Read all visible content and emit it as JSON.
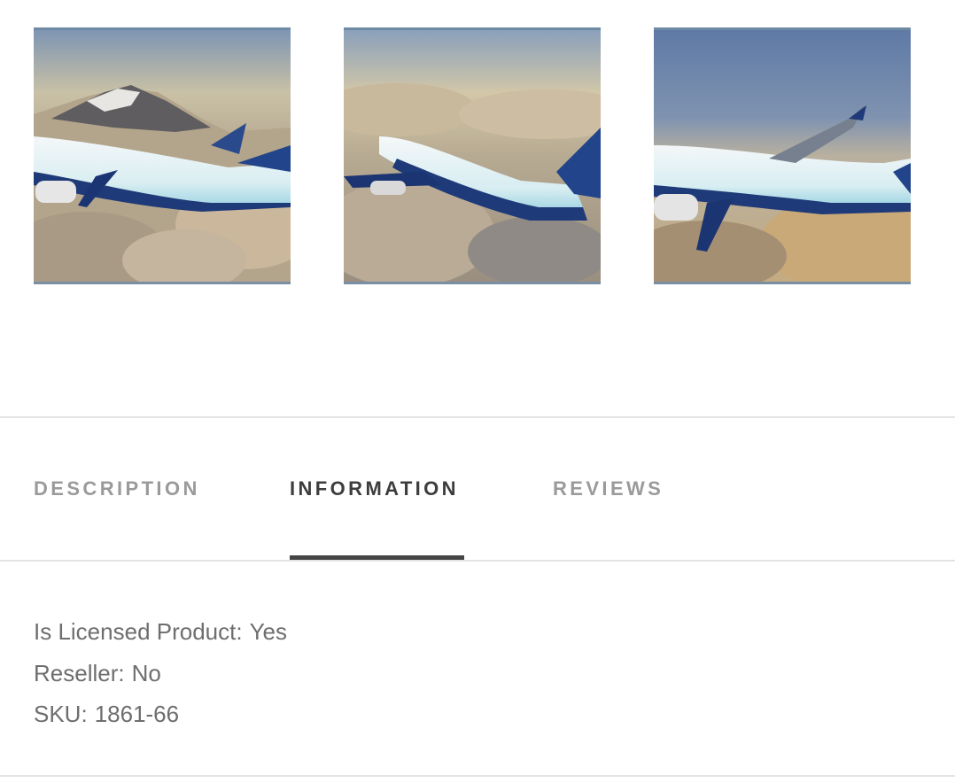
{
  "gallery": {
    "images": [
      {
        "alt": "Boeing 737 over mountain and clouds"
      },
      {
        "alt": "Boeing 737 banking above clouds"
      },
      {
        "alt": "Boeing 737 cruising above clouds"
      }
    ]
  },
  "tabs": [
    {
      "label": "DESCRIPTION",
      "active": false
    },
    {
      "label": "INFORMATION",
      "active": true
    },
    {
      "label": "REVIEWS",
      "active": false
    }
  ],
  "information": {
    "rows": [
      {
        "label": "Is Licensed Product:",
        "value": "Yes"
      },
      {
        "label": "Reseller:",
        "value": "No"
      },
      {
        "label": "SKU:",
        "value": "1861-66"
      }
    ]
  },
  "colors": {
    "active_tab": "#3d3d3d",
    "inactive_tab": "#9a9a9a",
    "indicator": "#444444",
    "divider": "#e4e4e4",
    "livery_blue": "#1e3a78"
  }
}
